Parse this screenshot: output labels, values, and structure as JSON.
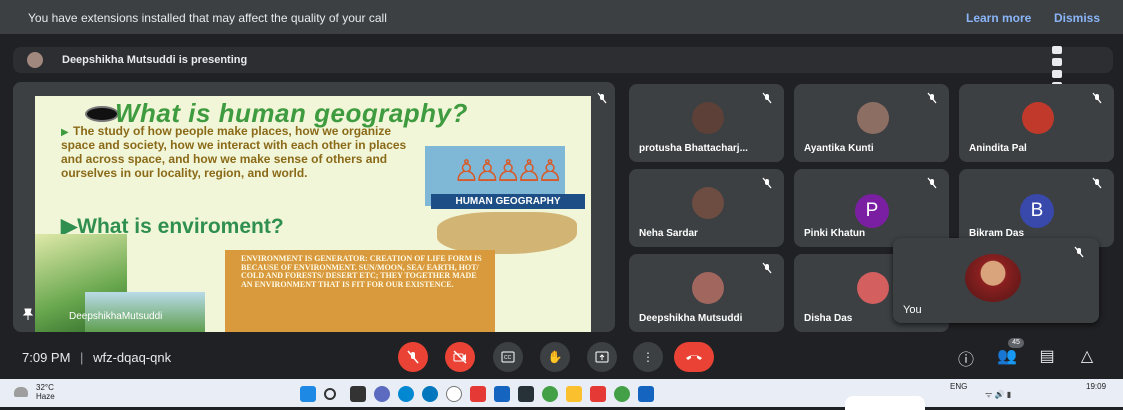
{
  "banner": {
    "message": "You have extensions installed that may affect the quality of your call",
    "learn_more": "Learn more",
    "dismiss": "Dismiss"
  },
  "presenting": {
    "text": "Deepshikha Mutsuddi is presenting"
  },
  "presentation": {
    "title": "What is human geography?",
    "body": "The study of how people make places, how we organize space and society, how we interact with each other in places and across space, and how we make sense of others and ourselves in our locality, region, and world.",
    "image_label": "HUMAN GEOGRAPHY",
    "subtitle": "What is enviroment?",
    "env_text": "ENVIRONMENT IS GENERATOR: CREATION OF LIFE FORM IS BECAUSE OF ENVIRONMENT. SUN/MOON, SEA/ EARTH, HOT/ COLD AND FORESTS/ DESERT ETC; THEY TOGETHER MADE AN ENVIRONMENT THAT IS FIT FOR OUR EXISTENCE.",
    "presenter": "DeepshikhaMutsuddi"
  },
  "participants": [
    {
      "name": "protusha Bhattacharj...",
      "type": "photo",
      "color": "#5d4037"
    },
    {
      "name": "Ayantika Kunti",
      "type": "photo",
      "color": "#8d6e63"
    },
    {
      "name": "Anindita Pal",
      "type": "photo",
      "color": "#c0392b"
    },
    {
      "name": "Neha Sardar",
      "type": "photo",
      "color": "#6d4c41"
    },
    {
      "name": "Pinki Khatun",
      "type": "letter",
      "letter": "P",
      "color": "#7b1fa2"
    },
    {
      "name": "Bikram Das",
      "type": "letter",
      "letter": "B",
      "color": "#3949ab"
    },
    {
      "name": "Deepshikha Mutsuddi",
      "type": "photo",
      "color": "#a1665e"
    },
    {
      "name": "Disha Das",
      "type": "photo",
      "color": "#d35f5f"
    }
  ],
  "self_view": {
    "label": "You"
  },
  "meeting": {
    "time": "7:09 PM",
    "separator": "|",
    "code": "wfz-dqaq-qnk"
  },
  "people_count": "45",
  "taskbar": {
    "temp": "32°C",
    "weather": "Haze",
    "lang": "ENG",
    "time": "19:09"
  },
  "colors": {
    "danger": "#ea4335",
    "accent": "#8ab4f8",
    "background": "#202124",
    "tile": "#3c4043"
  }
}
